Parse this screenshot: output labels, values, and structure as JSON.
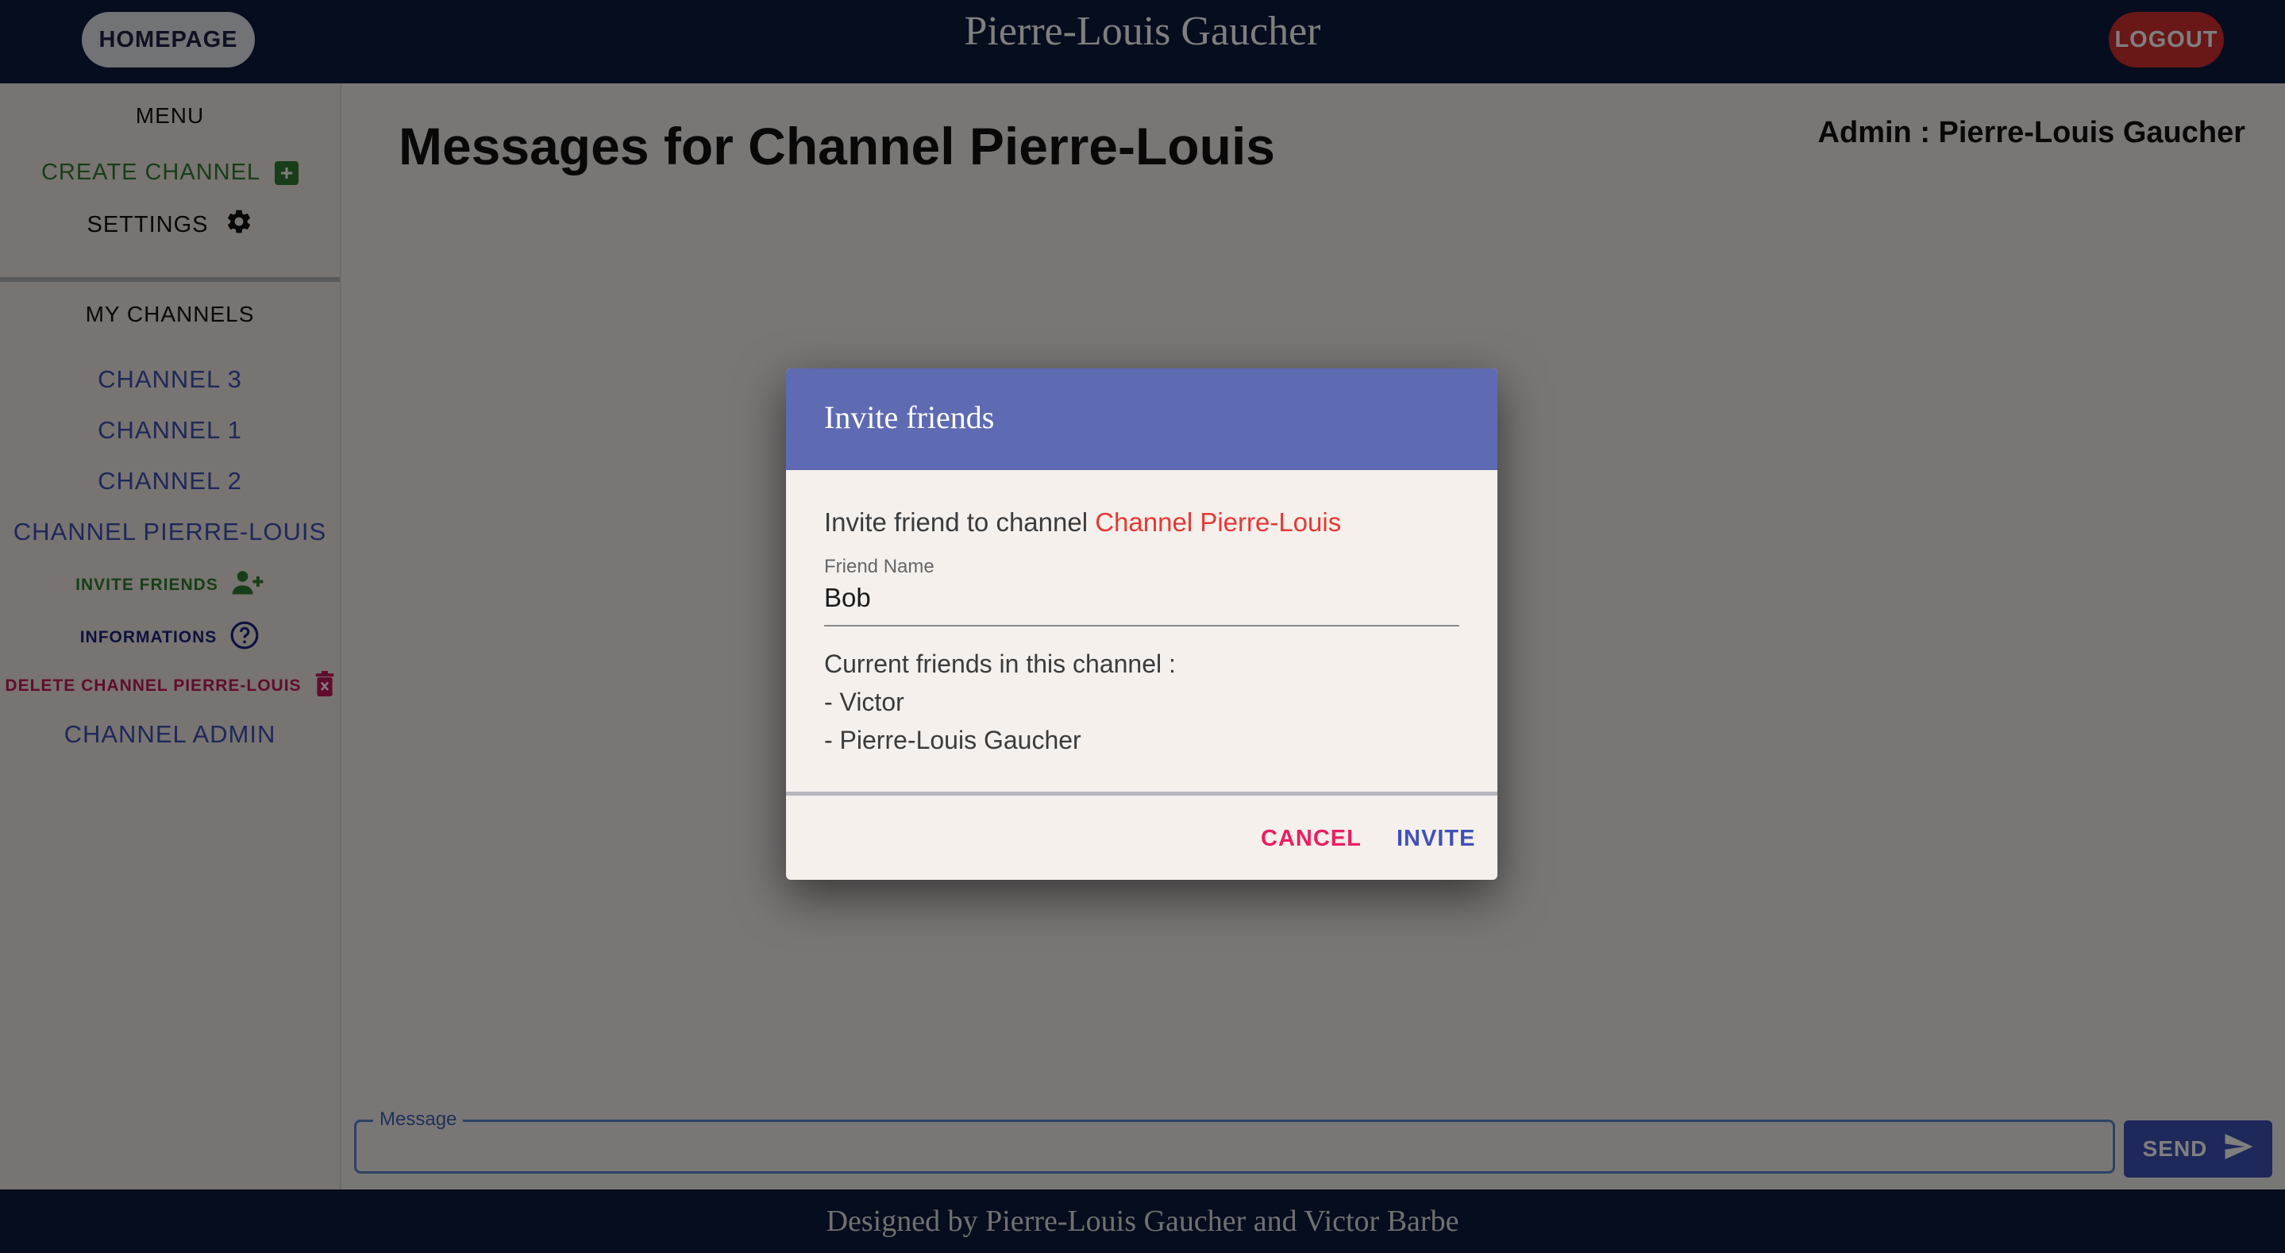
{
  "header": {
    "homepage_label": "HOMEPAGE",
    "site_title": "Pierre-Louis Gaucher",
    "logout_label": "LOGOUT"
  },
  "sidebar": {
    "menu_title": "MENU",
    "create_channel_label": "CREATE CHANNEL",
    "settings_label": "SETTINGS",
    "my_channels_title": "MY CHANNELS",
    "channels": [
      "CHANNEL 3",
      "CHANNEL 1",
      "CHANNEL 2",
      "CHANNEL PIERRE-LOUIS"
    ],
    "invite_friends_label": "INVITE FRIENDS",
    "informations_label": "INFORMATIONS",
    "delete_channel_label": "DELETE CHANNEL PIERRE-LOUIS",
    "channel_admin_label": "CHANNEL ADMIN"
  },
  "main": {
    "title": "Messages for Channel Pierre-Louis",
    "admin_label": "Admin : Pierre-Louis Gaucher",
    "message_label": "Message",
    "send_label": "SEND"
  },
  "dialog": {
    "title": "Invite friends",
    "invite_text": "Invite friend to channel",
    "channel_name": "Channel Pierre-Louis",
    "field_label": "Friend Name",
    "field_value": "Bob",
    "friends_title": "Current friends in this channel :",
    "friends": [
      "- Victor",
      "- Pierre-Louis Gaucher"
    ],
    "cancel_label": "CANCEL",
    "invite_label": "INVITE"
  },
  "footer": {
    "text": "Designed by Pierre-Louis Gaucher and Victor Barbe"
  },
  "colors": {
    "header_bg": "#0b1a3d",
    "channel_link": "#3f51b5",
    "accent_red": "#e53935",
    "green": "#2e7d32",
    "cancel": "#e91e63"
  },
  "icons": [
    "plus-square-icon",
    "gear-icon",
    "person-add-icon",
    "help-circle-icon",
    "trash-icon",
    "send-icon"
  ]
}
